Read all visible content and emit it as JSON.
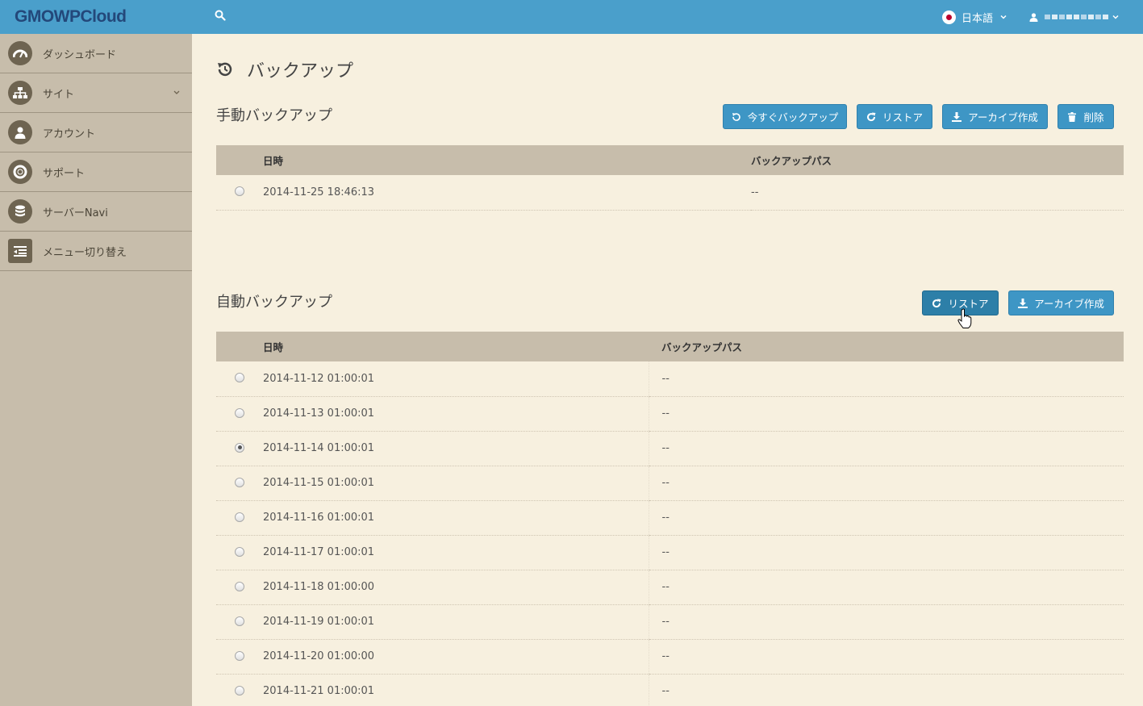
{
  "header": {
    "logo": "GMOWPCloud",
    "language": "日本語",
    "user_name": ""
  },
  "sidebar": {
    "items": [
      {
        "label": "ダッシュボード",
        "icon": "dashboard-icon"
      },
      {
        "label": "サイト",
        "icon": "sitemap-icon",
        "has_chevron": true
      },
      {
        "label": "アカウント",
        "icon": "user-icon"
      },
      {
        "label": "サポート",
        "icon": "lifebuoy-icon"
      },
      {
        "label": "サーバーNavi",
        "icon": "database-icon"
      },
      {
        "label": "メニュー切り替え",
        "icon": "menu-toggle-icon"
      }
    ]
  },
  "page": {
    "title": "バックアップ"
  },
  "manual": {
    "title": "手動バックアップ",
    "buttons": {
      "backup_now": "今すぐバックアップ",
      "restore": "リストア",
      "archive": "アーカイブ作成",
      "delete": "削除"
    },
    "columns": {
      "datetime": "日時",
      "path": "バックアップパス"
    },
    "rows": [
      {
        "datetime": "2014-11-25 18:46:13",
        "path": "--",
        "selected": false
      }
    ]
  },
  "auto": {
    "title": "自動バックアップ",
    "buttons": {
      "restore": "リストア",
      "archive": "アーカイブ作成"
    },
    "columns": {
      "datetime": "日時",
      "path": "バックアップパス"
    },
    "rows": [
      {
        "datetime": "2014-11-12 01:00:01",
        "path": "--",
        "selected": false
      },
      {
        "datetime": "2014-11-13 01:00:01",
        "path": "--",
        "selected": false
      },
      {
        "datetime": "2014-11-14 01:00:01",
        "path": "--",
        "selected": true
      },
      {
        "datetime": "2014-11-15 01:00:01",
        "path": "--",
        "selected": false
      },
      {
        "datetime": "2014-11-16 01:00:01",
        "path": "--",
        "selected": false
      },
      {
        "datetime": "2014-11-17 01:00:01",
        "path": "--",
        "selected": false
      },
      {
        "datetime": "2014-11-18 01:00:00",
        "path": "--",
        "selected": false
      },
      {
        "datetime": "2014-11-19 01:00:01",
        "path": "--",
        "selected": false
      },
      {
        "datetime": "2014-11-20 01:00:00",
        "path": "--",
        "selected": false
      },
      {
        "datetime": "2014-11-21 01:00:01",
        "path": "--",
        "selected": false
      }
    ]
  },
  "colors": {
    "topbar": "#4a9fcb",
    "sidebar": "#c7bdab",
    "background": "#f7f0df",
    "button": "#3e96c5",
    "logo": "#23487a"
  }
}
